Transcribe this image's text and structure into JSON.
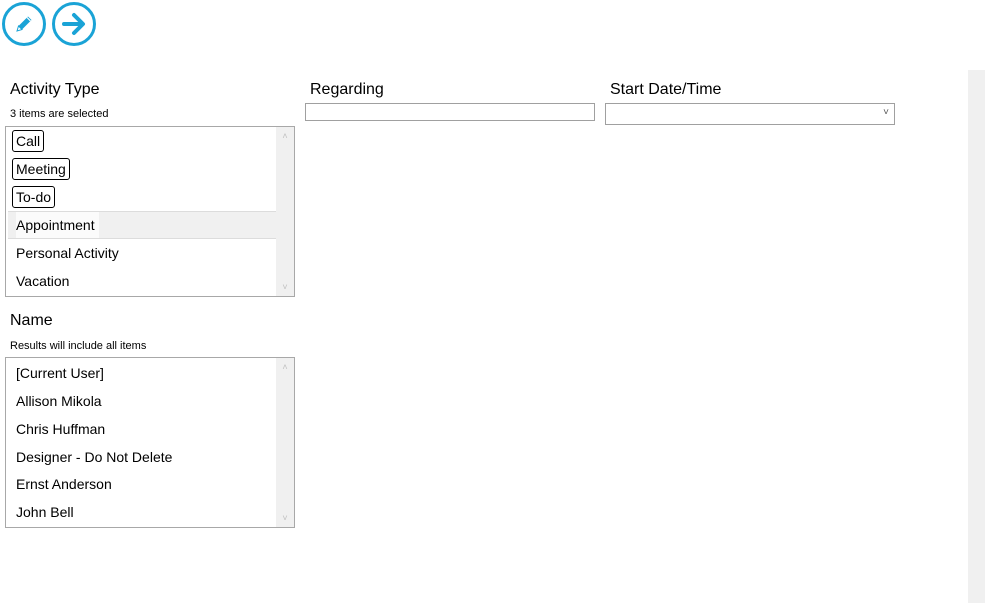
{
  "toolbar": {
    "edit_icon": "pencil-icon",
    "next_icon": "arrow-right-icon",
    "accent_color": "#1aa3d6"
  },
  "activity_type": {
    "label": "Activity Type",
    "sub": "3 items are selected",
    "items": [
      {
        "label": "Call",
        "selected": true
      },
      {
        "label": "Meeting",
        "selected": true
      },
      {
        "label": "To-do",
        "selected": true
      },
      {
        "label": "Appointment",
        "selected": false,
        "hover": true
      },
      {
        "label": "Personal Activity",
        "selected": false
      },
      {
        "label": "Vacation",
        "selected": false
      }
    ]
  },
  "name": {
    "label": "Name",
    "sub": "Results will include all items",
    "items": [
      {
        "label": "[Current User]"
      },
      {
        "label": "Allison Mikola"
      },
      {
        "label": "Chris Huffman"
      },
      {
        "label": "Designer - Do Not Delete"
      },
      {
        "label": "Ernst Anderson"
      },
      {
        "label": "John Bell"
      }
    ]
  },
  "regarding": {
    "label": "Regarding",
    "value": "",
    "placeholder": ""
  },
  "start_datetime": {
    "label": "Start Date/Time",
    "value": ""
  }
}
